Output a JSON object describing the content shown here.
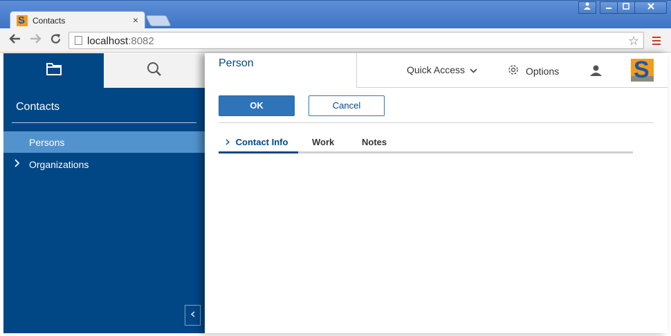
{
  "browser": {
    "tab_title": "Contacts",
    "tab_close": "×",
    "favicon_letter": "S",
    "url_host": "localhost",
    "url_port": ":8082",
    "window_controls": [
      "user-icon",
      "minimize-icon",
      "maximize-icon",
      "close-icon"
    ]
  },
  "sidebar": {
    "heading": "Contacts",
    "items": [
      {
        "label": "Persons",
        "selected": true,
        "expandable": false
      },
      {
        "label": "Organizations",
        "selected": false,
        "expandable": true
      }
    ],
    "tabs": [
      "folder-icon",
      "search-icon"
    ]
  },
  "form": {
    "title": "Person",
    "ok_label": "OK",
    "cancel_label": "Cancel",
    "tabs": [
      {
        "label": "Contact Info",
        "active": true
      },
      {
        "label": "Work",
        "active": false
      },
      {
        "label": "Notes",
        "active": false
      }
    ]
  },
  "header": {
    "quick_access_label": "Quick Access",
    "options_label": "Options",
    "logo_letter": "S"
  },
  "colors": {
    "primary": "#014786",
    "selected_item": "#5293ce",
    "button_primary": "#2f74b8",
    "logo_orange": "#f29b1d"
  }
}
